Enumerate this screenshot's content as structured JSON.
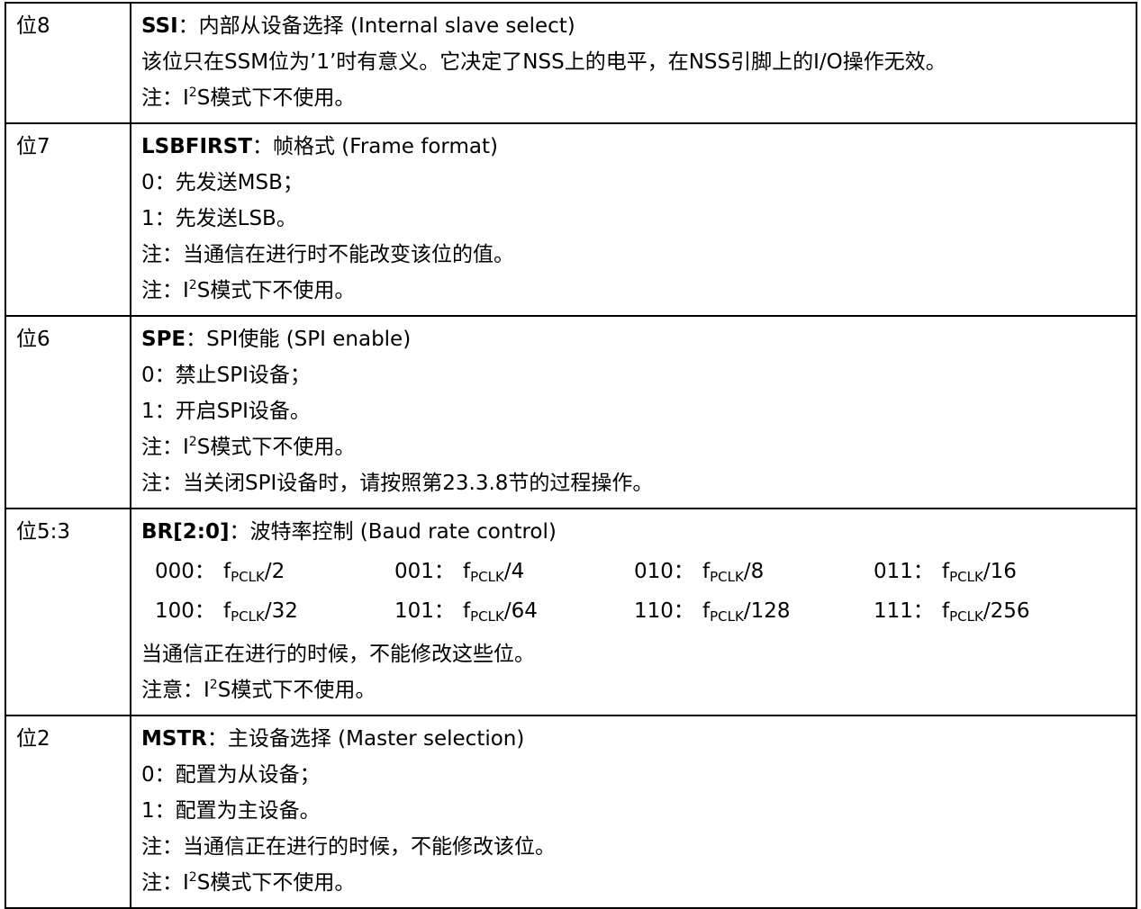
{
  "rows": [
    {
      "bit": "位8",
      "field": "SSI",
      "title_rest": "：内部从设备选择 (Internal slave select)",
      "lines": [
        {
          "text": "该位只在SSM位为’1’时有意义。它决定了NSS上的电平，在NSS引脚上的I/O操作无效。"
        },
        {
          "pre": "注：I",
          "sup": "2",
          "post": "S模式下不使用。"
        }
      ]
    },
    {
      "bit": "位7",
      "field": "LSBFIRST",
      "title_rest": "：帧格式 (Frame format)",
      "lines": [
        {
          "text": "0：先发送MSB；"
        },
        {
          "text": "1：先发送LSB。"
        },
        {
          "text": "注：当通信在进行时不能改变该位的值。"
        },
        {
          "pre": "注：I",
          "sup": "2",
          "post": "S模式下不使用。"
        }
      ]
    },
    {
      "bit": "位6",
      "field": "SPE",
      "title_rest": "：SPI使能 (SPI enable)",
      "lines": [
        {
          "text": "0：禁止SPI设备；"
        },
        {
          "text": "1：开启SPI设备。"
        },
        {
          "pre": "注：I",
          "sup": "2",
          "post": "S模式下不使用。"
        },
        {
          "text": "注：当关闭SPI设备时，请按照第23.3.8节的过程操作。"
        }
      ]
    },
    {
      "bit": "位5:3",
      "field": "BR[2:0]",
      "title_rest": "：波特率控制 (Baud rate control)",
      "baud_rates": [
        {
          "code": "000：",
          "f": "f",
          "sub": "PCLK",
          "div": "/2"
        },
        {
          "code": "001：",
          "f": "f",
          "sub": "PCLK",
          "div": "/4"
        },
        {
          "code": "010：",
          "f": "f",
          "sub": "PCLK",
          "div": "/8"
        },
        {
          "code": "011：",
          "f": "f",
          "sub": "PCLK",
          "div": "/16"
        },
        {
          "code": "100：",
          "f": "f",
          "sub": "PCLK",
          "div": "/32"
        },
        {
          "code": "101：",
          "f": "f",
          "sub": "PCLK",
          "div": "/64"
        },
        {
          "code": "110：",
          "f": "f",
          "sub": "PCLK",
          "div": "/128"
        },
        {
          "code": "111：",
          "f": "f",
          "sub": "PCLK",
          "div": "/256"
        }
      ],
      "lines": [
        {
          "text": "当通信正在进行的时候，不能修改这些位。"
        },
        {
          "pre": "注意：I",
          "sup": "2",
          "post": "S模式下不使用。"
        }
      ]
    },
    {
      "bit": "位2",
      "field": "MSTR",
      "title_rest": "：主设备选择 (Master selection)",
      "lines": [
        {
          "text": "0：配置为从设备；"
        },
        {
          "text": "1：配置为主设备。"
        },
        {
          "text": "注：当通信正在进行的时候，不能修改该位。"
        },
        {
          "pre": "注：I",
          "sup": "2",
          "post": "S模式下不使用。"
        }
      ]
    }
  ]
}
